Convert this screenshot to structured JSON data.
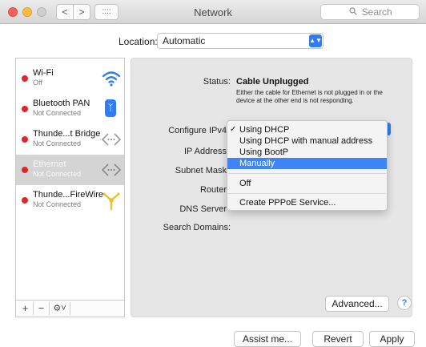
{
  "window": {
    "title": "Network",
    "search_placeholder": "Search",
    "search_icon": "magnifier-icon",
    "nav_back": "<",
    "nav_forward": ">",
    "nav_grid": "::::"
  },
  "location": {
    "label": "Location:",
    "value": "Automatic"
  },
  "services": [
    {
      "name": "Wi-Fi",
      "status": "Off",
      "icon": "wifi-icon",
      "selected": false
    },
    {
      "name": "Bluetooth PAN",
      "status": "Not Connected",
      "icon": "bluetooth-icon",
      "selected": false
    },
    {
      "name": "Thunde...t Bridge",
      "status": "Not Connected",
      "icon": "ethernet-arrows-icon",
      "selected": false
    },
    {
      "name": "Ethernet",
      "status": "Not Connected",
      "icon": "ethernet-arrows-icon",
      "selected": true
    },
    {
      "name": "Thunde...FireWire",
      "status": "Not Connected",
      "icon": "firewire-icon",
      "selected": false
    }
  ],
  "sidebar_controls": {
    "add": "+",
    "remove": "−",
    "actions": "⚙˅"
  },
  "details": {
    "status_label": "Status:",
    "status_value": "Cable Unplugged",
    "status_description": "Either the cable for Ethernet is not plugged in or the device at the other end is not responding.",
    "configure_label": "Configure IPv4",
    "ip_label": "IP Address",
    "subnet_label": "Subnet Mask",
    "router_label": "Router",
    "dns_label": "DNS Server",
    "search_domains_label": "Search Domains:"
  },
  "configure_menu": {
    "items": [
      "Using DHCP",
      "Using DHCP with manual address",
      "Using BootP",
      "Manually",
      "Off",
      "Create PPPoE Service..."
    ],
    "checked": "Using DHCP",
    "highlighted": "Manually",
    "check_mark": "✓"
  },
  "buttons": {
    "advanced": "Advanced...",
    "help": "?",
    "assist": "Assist me...",
    "revert": "Revert",
    "apply": "Apply"
  },
  "colors": {
    "status_red": "#e3242b",
    "accent_blue": "#2f7cf6",
    "menu_highlight": "#3f84f2"
  }
}
